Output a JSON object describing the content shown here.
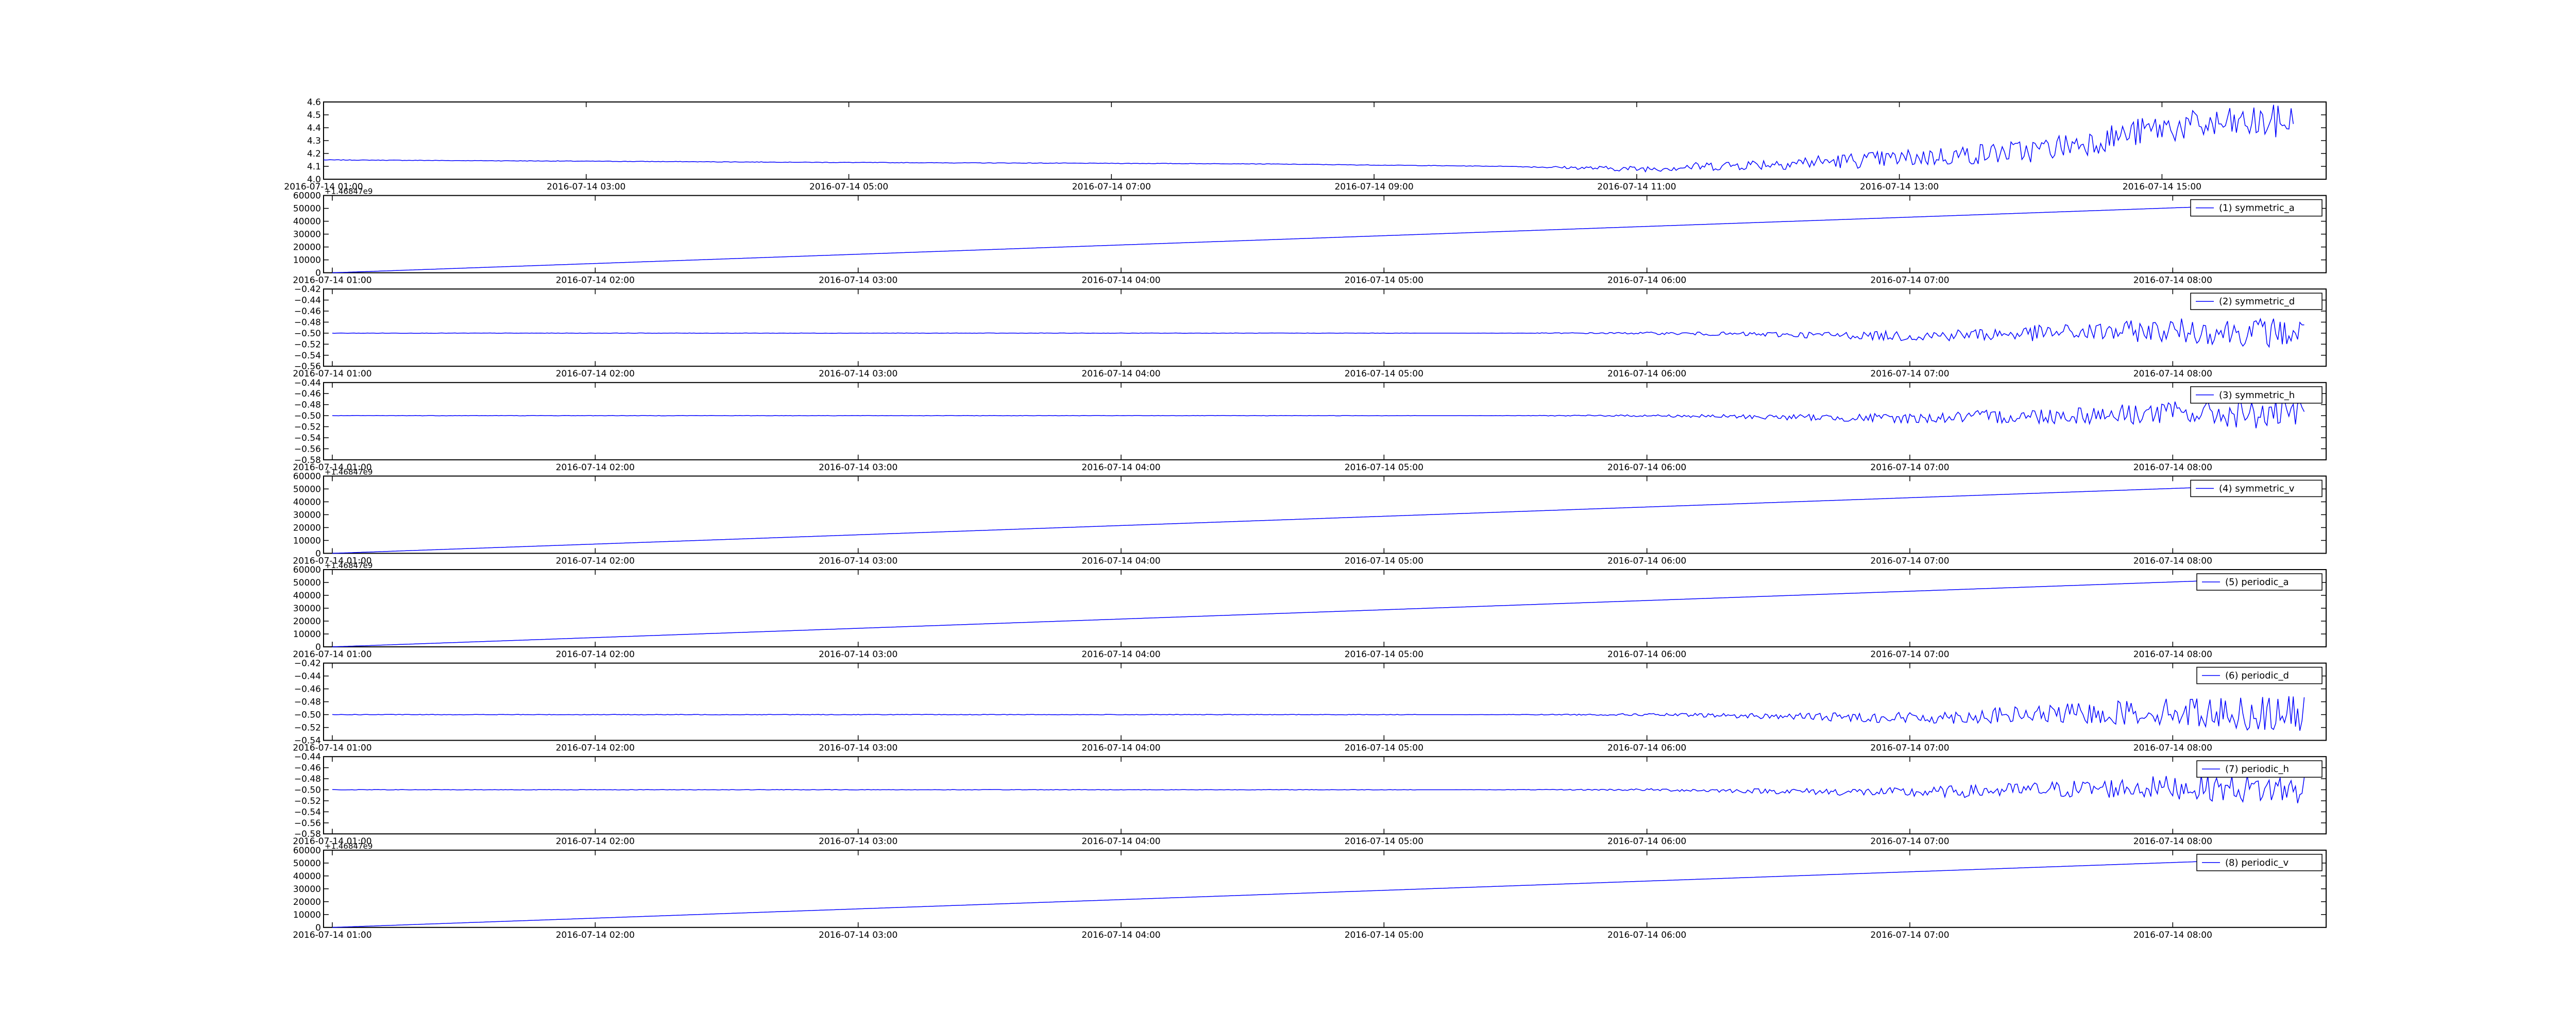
{
  "figure": {
    "line_color": "#0000ff",
    "axes_color": "#000000",
    "background": "#ffffff"
  },
  "chart_data": [
    {
      "type": "line",
      "name": "",
      "x_tick_labels": [
        "2016-07-14 01:00",
        "2016-07-14 03:00",
        "2016-07-14 05:00",
        "2016-07-14 07:00",
        "2016-07-14 09:00",
        "2016-07-14 11:00",
        "2016-07-14 13:00",
        "2016-07-14 15:00"
      ],
      "y_tick_labels": [
        "4.0",
        "4.1",
        "4.2",
        "4.3",
        "4.4",
        "4.5",
        "4.6"
      ],
      "ylim": [
        4.0,
        4.6
      ],
      "xlim": [
        "2016-07-14 01:00",
        "2016-07-14 16:15"
      ],
      "legend": null,
      "offset_text": "",
      "series": [
        {
          "x": [
            "2016-07-14 01:00",
            "2016-07-14 05:00",
            "2016-07-14 08:00",
            "2016-07-14 10:00",
            "2016-07-14 11:00",
            "2016-07-14 12:00",
            "2016-07-14 13:00",
            "2016-07-14 14:00",
            "2016-07-14 14:30",
            "2016-07-14 15:00",
            "2016-07-14 16:00"
          ],
          "y": [
            4.15,
            4.13,
            4.12,
            4.1,
            4.08,
            4.12,
            4.16,
            4.22,
            4.3,
            4.4,
            4.45
          ]
        }
      ]
    },
    {
      "type": "line",
      "name": "(1) symmetric_a",
      "x_tick_labels": [
        "2016-07-14 01:00",
        "2016-07-14 02:00",
        "2016-07-14 03:00",
        "2016-07-14 04:00",
        "2016-07-14 05:00",
        "2016-07-14 06:00",
        "2016-07-14 07:00",
        "2016-07-14 08:00"
      ],
      "y_tick_labels": [
        "0",
        "10000",
        "20000",
        "30000",
        "40000",
        "50000",
        "60000"
      ],
      "ylim": [
        0,
        60000
      ],
      "xlim": [
        "2016-07-14 00:58",
        "2016-07-14 08:35"
      ],
      "legend": "(1) symmetric_a",
      "offset_text": "+1.46847e9",
      "series": [
        {
          "x": [
            "2016-07-14 01:00",
            "2016-07-14 08:30"
          ],
          "y": [
            0,
            54000
          ]
        }
      ]
    },
    {
      "type": "line",
      "name": "(2) symmetric_d",
      "x_tick_labels": [
        "2016-07-14 01:00",
        "2016-07-14 02:00",
        "2016-07-14 03:00",
        "2016-07-14 04:00",
        "2016-07-14 05:00",
        "2016-07-14 06:00",
        "2016-07-14 07:00",
        "2016-07-14 08:00"
      ],
      "y_tick_labels": [
        "−0.56",
        "−0.54",
        "−0.52",
        "−0.50",
        "−0.48",
        "−0.46",
        "−0.44",
        "−0.42"
      ],
      "ylim": [
        -0.56,
        -0.42
      ],
      "xlim": [
        "2016-07-14 00:58",
        "2016-07-14 08:35"
      ],
      "legend": "(2) symmetric_d",
      "offset_text": "",
      "series": [
        {
          "x": [
            "2016-07-14 01:00",
            "2016-07-14 05:00",
            "2016-07-14 06:00",
            "2016-07-14 07:00",
            "2016-07-14 07:30",
            "2016-07-14 08:00",
            "2016-07-14 08:30"
          ],
          "y": [
            -0.5,
            -0.5,
            -0.5,
            -0.505,
            -0.5,
            -0.495,
            -0.5
          ]
        }
      ]
    },
    {
      "type": "line",
      "name": "(3) symmetric_h",
      "x_tick_labels": [
        "2016-07-14 01:00",
        "2016-07-14 02:00",
        "2016-07-14 03:00",
        "2016-07-14 04:00",
        "2016-07-14 05:00",
        "2016-07-14 06:00",
        "2016-07-14 07:00",
        "2016-07-14 08:00"
      ],
      "y_tick_labels": [
        "−0.58",
        "−0.56",
        "−0.54",
        "−0.52",
        "−0.50",
        "−0.48",
        "−0.46",
        "−0.44"
      ],
      "ylim": [
        -0.58,
        -0.44
      ],
      "xlim": [
        "2016-07-14 00:58",
        "2016-07-14 08:35"
      ],
      "legend": "(3) symmetric_h",
      "offset_text": "",
      "series": [
        {
          "x": [
            "2016-07-14 01:00",
            "2016-07-14 05:00",
            "2016-07-14 06:00",
            "2016-07-14 07:00",
            "2016-07-14 07:30",
            "2016-07-14 08:00",
            "2016-07-14 08:30"
          ],
          "y": [
            -0.5,
            -0.5,
            -0.5,
            -0.505,
            -0.5,
            -0.495,
            -0.5
          ]
        }
      ]
    },
    {
      "type": "line",
      "name": "(4) symmetric_v",
      "x_tick_labels": [
        "2016-07-14 01:00",
        "2016-07-14 02:00",
        "2016-07-14 03:00",
        "2016-07-14 04:00",
        "2016-07-14 05:00",
        "2016-07-14 06:00",
        "2016-07-14 07:00",
        "2016-07-14 08:00"
      ],
      "y_tick_labels": [
        "0",
        "10000",
        "20000",
        "30000",
        "40000",
        "50000",
        "60000"
      ],
      "ylim": [
        0,
        60000
      ],
      "xlim": [
        "2016-07-14 00:58",
        "2016-07-14 08:35"
      ],
      "legend": "(4) symmetric_v",
      "offset_text": "+1.46847e9",
      "series": [
        {
          "x": [
            "2016-07-14 01:00",
            "2016-07-14 08:30"
          ],
          "y": [
            0,
            54000
          ]
        }
      ]
    },
    {
      "type": "line",
      "name": "(5) periodic_a",
      "x_tick_labels": [
        "2016-07-14 01:00",
        "2016-07-14 02:00",
        "2016-07-14 03:00",
        "2016-07-14 04:00",
        "2016-07-14 05:00",
        "2016-07-14 06:00",
        "2016-07-14 07:00",
        "2016-07-14 08:00"
      ],
      "y_tick_labels": [
        "0",
        "10000",
        "20000",
        "30000",
        "40000",
        "50000",
        "60000"
      ],
      "ylim": [
        0,
        60000
      ],
      "xlim": [
        "2016-07-14 00:58",
        "2016-07-14 08:35"
      ],
      "legend": "(5) periodic_a",
      "offset_text": "+1.46847e9",
      "series": [
        {
          "x": [
            "2016-07-14 01:00",
            "2016-07-14 08:30"
          ],
          "y": [
            0,
            54000
          ]
        }
      ]
    },
    {
      "type": "line",
      "name": "(6) periodic_d",
      "x_tick_labels": [
        "2016-07-14 01:00",
        "2016-07-14 02:00",
        "2016-07-14 03:00",
        "2016-07-14 04:00",
        "2016-07-14 05:00",
        "2016-07-14 06:00",
        "2016-07-14 07:00",
        "2016-07-14 08:00"
      ],
      "y_tick_labels": [
        "−0.54",
        "−0.52",
        "−0.50",
        "−0.48",
        "−0.46",
        "−0.44",
        "−0.42"
      ],
      "ylim": [
        -0.54,
        -0.42
      ],
      "xlim": [
        "2016-07-14 00:58",
        "2016-07-14 08:35"
      ],
      "legend": "(6) periodic_d",
      "offset_text": "",
      "series": [
        {
          "x": [
            "2016-07-14 01:00",
            "2016-07-14 05:00",
            "2016-07-14 06:00",
            "2016-07-14 07:00",
            "2016-07-14 07:30",
            "2016-07-14 08:00",
            "2016-07-14 08:30"
          ],
          "y": [
            -0.5,
            -0.5,
            -0.5,
            -0.505,
            -0.5,
            -0.495,
            -0.5
          ]
        }
      ]
    },
    {
      "type": "line",
      "name": "(7) periodic_h",
      "x_tick_labels": [
        "2016-07-14 01:00",
        "2016-07-14 02:00",
        "2016-07-14 03:00",
        "2016-07-14 04:00",
        "2016-07-14 05:00",
        "2016-07-14 06:00",
        "2016-07-14 07:00",
        "2016-07-14 08:00"
      ],
      "y_tick_labels": [
        "−0.58",
        "−0.56",
        "−0.54",
        "−0.52",
        "−0.50",
        "−0.48",
        "−0.46",
        "−0.44"
      ],
      "ylim": [
        -0.58,
        -0.44
      ],
      "xlim": [
        "2016-07-14 00:58",
        "2016-07-14 08:35"
      ],
      "legend": "(7) periodic_h",
      "offset_text": "",
      "series": [
        {
          "x": [
            "2016-07-14 01:00",
            "2016-07-14 05:00",
            "2016-07-14 06:00",
            "2016-07-14 07:00",
            "2016-07-14 07:30",
            "2016-07-14 08:00",
            "2016-07-14 08:30"
          ],
          "y": [
            -0.5,
            -0.5,
            -0.5,
            -0.505,
            -0.5,
            -0.495,
            -0.5
          ]
        }
      ]
    },
    {
      "type": "line",
      "name": "(8) periodic_v",
      "x_tick_labels": [
        "2016-07-14 01:00",
        "2016-07-14 02:00",
        "2016-07-14 03:00",
        "2016-07-14 04:00",
        "2016-07-14 05:00",
        "2016-07-14 06:00",
        "2016-07-14 07:00",
        "2016-07-14 08:00"
      ],
      "y_tick_labels": [
        "0",
        "10000",
        "20000",
        "30000",
        "40000",
        "50000",
        "60000"
      ],
      "ylim": [
        0,
        60000
      ],
      "xlim": [
        "2016-07-14 00:58",
        "2016-07-14 08:35"
      ],
      "legend": "(8) periodic_v",
      "offset_text": "+1.46847e9",
      "series": [
        {
          "x": [
            "2016-07-14 01:00",
            "2016-07-14 08:30"
          ],
          "y": [
            0,
            54000
          ]
        }
      ]
    }
  ]
}
